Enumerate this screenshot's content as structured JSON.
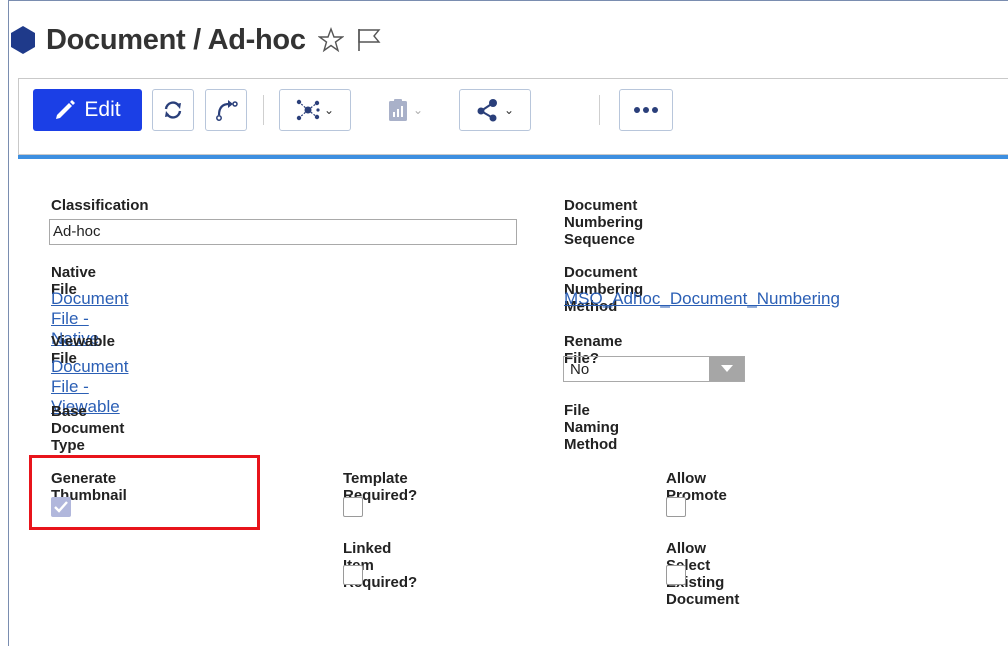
{
  "header": {
    "title": "Document / Ad-hoc",
    "icon": "hexagon-icon",
    "favorite_icon": "star-icon",
    "flag_icon": "flag-icon",
    "accent": "#1f3a8a"
  },
  "toolbar": {
    "edit_label": "Edit",
    "edit_color": "#1b3fe6",
    "buttons": [
      "edit-button",
      "refresh-button",
      "lifecycle-button",
      "structure-browser-button",
      "reports-button",
      "share-button",
      "more-button"
    ]
  },
  "form": {
    "classification_label": "Classification",
    "classification_value": "Ad-hoc",
    "native_file_label": "Native File",
    "native_file_value": "Document File - Native",
    "viewable_file_label": "Viewable File",
    "viewable_file_value": "Document File - Viewable",
    "base_doc_type_label": "Base Document Type",
    "doc_numbering_seq_label": "Document Numbering Sequence",
    "doc_numbering_method_label": "Document Numbering Method",
    "doc_numbering_method_value": "MSO_Adhoc_Document_Numbering",
    "rename_file_label": "Rename File?",
    "rename_file_value": "No",
    "file_naming_method_label": "File Naming Method",
    "generate_thumbnail_label": "Generate Thumbnail",
    "generate_thumbnail_checked": true,
    "template_required_label": "Template Required?",
    "template_required_checked": false,
    "allow_promote_label": "Allow Promote",
    "allow_promote_checked": false,
    "linked_item_required_label": "Linked Item Required?",
    "linked_item_required_checked": false,
    "allow_select_existing_label": "Allow Select Existing Document",
    "allow_select_existing_checked": false
  },
  "highlight_color": "#e8141b"
}
